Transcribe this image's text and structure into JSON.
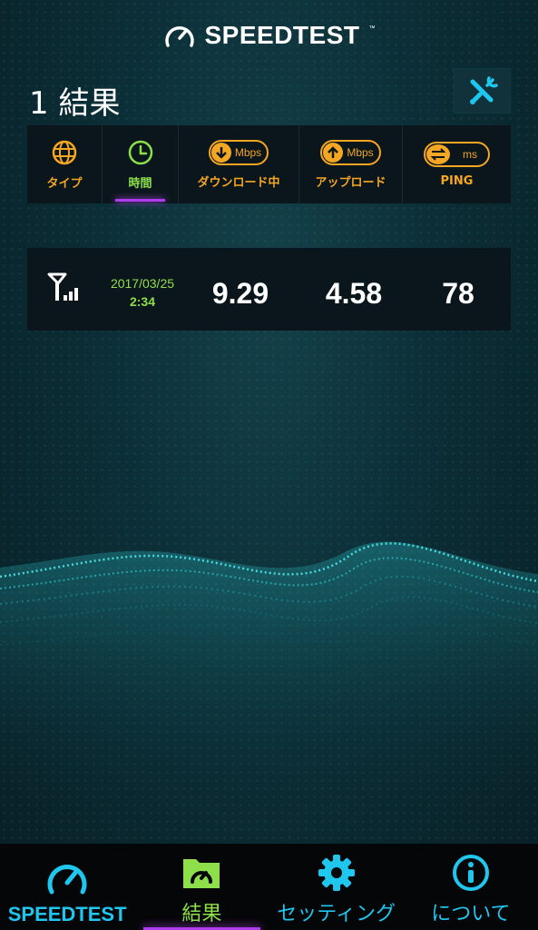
{
  "header": {
    "app_name": "SPEEDTEST",
    "trademark": "™"
  },
  "results": {
    "title": "1 結果"
  },
  "columns": {
    "type": "タイプ",
    "time": "時間",
    "download": "ダウンロード中",
    "download_unit": "Mbps",
    "upload": "アップロード",
    "upload_unit": "Mbps",
    "ping": "PING",
    "ping_unit": "ms"
  },
  "rows": [
    {
      "connection_icon": "cellular-signal-icon",
      "date": "2017/03/25",
      "time": "2:34",
      "download": "9.29",
      "upload": "4.58",
      "ping": "78"
    }
  ],
  "tabs": [
    {
      "label": "SPEEDTEST",
      "icon": "speedometer-icon"
    },
    {
      "label": "結果",
      "icon": "results-folder-icon"
    },
    {
      "label": "セッティング",
      "icon": "gear-icon"
    },
    {
      "label": "について",
      "icon": "info-icon"
    }
  ],
  "colors": {
    "accent_cyan": "#1fc6ee",
    "accent_orange": "#f5a623",
    "accent_green": "#8de04a",
    "active_purple": "#b03cf0"
  }
}
